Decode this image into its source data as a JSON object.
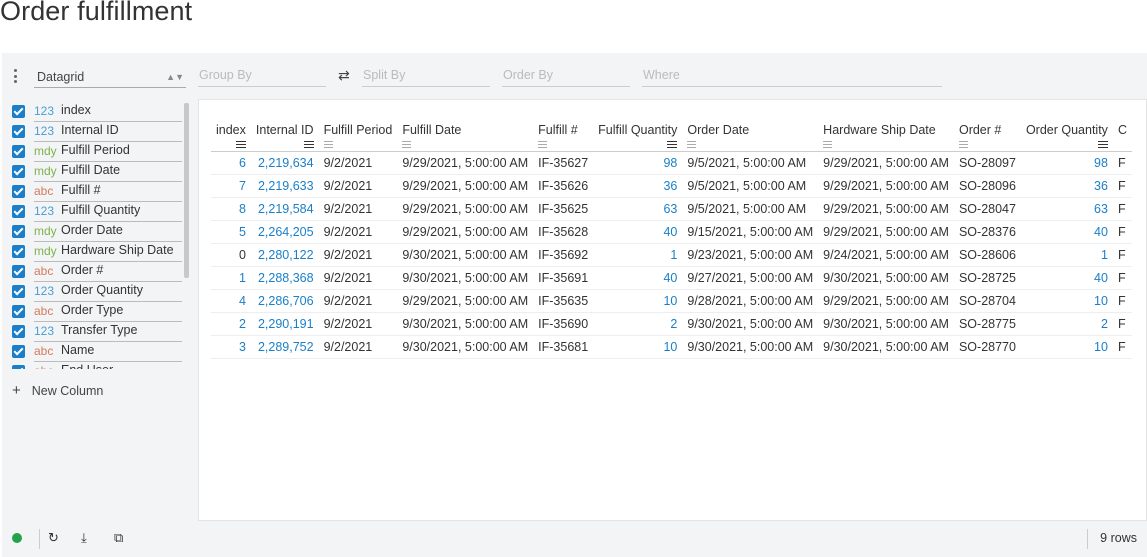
{
  "title": "Order fulfillment",
  "toolbar": {
    "plugin": "Datagrid",
    "group_by": "Group By",
    "split_by": "Split By",
    "order_by": "Order By",
    "where": "Where"
  },
  "columns": [
    {
      "type": "123",
      "kind": "num",
      "name": "index"
    },
    {
      "type": "123",
      "kind": "num",
      "name": "Internal ID"
    },
    {
      "type": "mdy",
      "kind": "date",
      "name": "Fulfill Period"
    },
    {
      "type": "mdy",
      "kind": "date",
      "name": "Fulfill Date"
    },
    {
      "type": "abc",
      "kind": "str",
      "name": "Fulfill #"
    },
    {
      "type": "123",
      "kind": "num",
      "name": "Fulfill Quantity"
    },
    {
      "type": "mdy",
      "kind": "date",
      "name": "Order Date"
    },
    {
      "type": "mdy",
      "kind": "date",
      "name": "Hardware Ship Date"
    },
    {
      "type": "abc",
      "kind": "str",
      "name": "Order #"
    },
    {
      "type": "123",
      "kind": "num",
      "name": "Order Quantity"
    },
    {
      "type": "abc",
      "kind": "str",
      "name": "Order Type"
    },
    {
      "type": "123",
      "kind": "num",
      "name": "Transfer Type"
    },
    {
      "type": "abc",
      "kind": "str",
      "name": "Name"
    },
    {
      "type": "abc",
      "kind": "str",
      "name": "End User"
    }
  ],
  "new_column": "New Column",
  "grid": {
    "headers": [
      "index",
      "Internal ID",
      "Fulfill Period",
      "Fulfill Date",
      "Fulfill #",
      "Fulfill Quantity",
      "Order Date",
      "Hardware Ship Date",
      "Order #",
      "Order Quantity",
      "C"
    ],
    "rows": [
      [
        "6",
        "2,219,634",
        "9/2/2021",
        "9/29/2021, 5:00:00 AM",
        "IF-35627",
        "98",
        "9/5/2021, 5:00:00 AM",
        "9/29/2021, 5:00:00 AM",
        "SO-28097",
        "98",
        "F"
      ],
      [
        "7",
        "2,219,633",
        "9/2/2021",
        "9/29/2021, 5:00:00 AM",
        "IF-35626",
        "36",
        "9/5/2021, 5:00:00 AM",
        "9/29/2021, 5:00:00 AM",
        "SO-28096",
        "36",
        "F"
      ],
      [
        "8",
        "2,219,584",
        "9/2/2021",
        "9/29/2021, 5:00:00 AM",
        "IF-35625",
        "63",
        "9/5/2021, 5:00:00 AM",
        "9/29/2021, 5:00:00 AM",
        "SO-28047",
        "63",
        "F"
      ],
      [
        "5",
        "2,264,205",
        "9/2/2021",
        "9/29/2021, 5:00:00 AM",
        "IF-35628",
        "40",
        "9/15/2021, 5:00:00 AM",
        "9/29/2021, 5:00:00 AM",
        "SO-28376",
        "40",
        "F"
      ],
      [
        "0",
        "2,280,122",
        "9/2/2021",
        "9/30/2021, 5:00:00 AM",
        "IF-35692",
        "1",
        "9/23/2021, 5:00:00 AM",
        "9/24/2021, 5:00:00 AM",
        "SO-28606",
        "1",
        "F"
      ],
      [
        "1",
        "2,288,368",
        "9/2/2021",
        "9/30/2021, 5:00:00 AM",
        "IF-35691",
        "40",
        "9/27/2021, 5:00:00 AM",
        "9/30/2021, 5:00:00 AM",
        "SO-28725",
        "40",
        "F"
      ],
      [
        "4",
        "2,286,706",
        "9/2/2021",
        "9/29/2021, 5:00:00 AM",
        "IF-35635",
        "10",
        "9/28/2021, 5:00:00 AM",
        "9/29/2021, 5:00:00 AM",
        "SO-28704",
        "10",
        "F"
      ],
      [
        "2",
        "2,290,191",
        "9/2/2021",
        "9/30/2021, 5:00:00 AM",
        "IF-35690",
        "2",
        "9/30/2021, 5:00:00 AM",
        "9/30/2021, 5:00:00 AM",
        "SO-28775",
        "2",
        "F"
      ],
      [
        "3",
        "2,289,752",
        "9/2/2021",
        "9/30/2021, 5:00:00 AM",
        "IF-35681",
        "10",
        "9/30/2021, 5:00:00 AM",
        "9/30/2021, 5:00:00 AM",
        "SO-28770",
        "10",
        "F"
      ]
    ]
  },
  "status": {
    "row_count": "9 rows",
    "indicator_color": "#22a34a"
  }
}
